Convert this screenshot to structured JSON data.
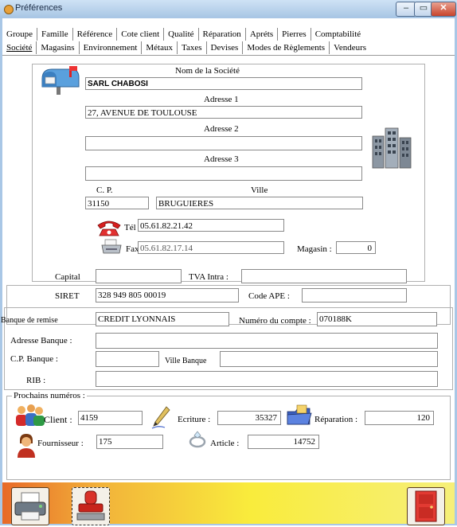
{
  "window": {
    "title": "Préférences",
    "controls": {
      "minimize": "–",
      "maximize": "▭",
      "close": "✕"
    }
  },
  "tabs_row1": [
    "Groupe",
    "Famille",
    "Référence",
    "Cote client",
    "Qualité",
    "Réparation",
    "Apréts",
    "Pierres",
    "Comptabilité"
  ],
  "tabs_row2": [
    "Société",
    "Magasins",
    "Environnement",
    "Métaux",
    "Taxes",
    "Devises",
    "Modes de Règlements",
    "Vendeurs"
  ],
  "company": {
    "name_label": "Nom de la Société",
    "name_value": "SARL CHABOSI",
    "address1_label": "Adresse 1",
    "address1_value": "27, AVENUE DE TOULOUSE",
    "address2_label": "Adresse 2",
    "address2_value": "",
    "address3_label": "Adresse 3",
    "address3_value": "",
    "cp_label": "C. P.",
    "cp_value": "31150",
    "ville_label": "Ville",
    "ville_value": "BRUGUIERES",
    "tel_label": "Tél :",
    "tel_value": "05.61.82.21.42",
    "fax_label": "Fax",
    "fax_value": "05.61.82.17.14",
    "magasin_label": "Magasin :",
    "magasin_value": "0"
  },
  "legal": {
    "capital_label": "Capital",
    "capital_value": "",
    "tva_label": "TVA Intra :",
    "tva_value": "",
    "siret_label": "SIRET",
    "siret_value": "328 949 805 00019",
    "ape_label": "Code APE :",
    "ape_value": ""
  },
  "bank": {
    "banque_label": "Banque de remise",
    "banque_value": "CREDIT LYONNAIS",
    "compte_label": "Numéro du compte :",
    "compte_value": "070188K",
    "adresse_label": "Adresse Banque :",
    "adresse_value": "",
    "cp_label": "C.P. Banque :",
    "cp_value": "",
    "ville_label": "Ville Banque",
    "ville_value": "",
    "rib_label": "RIB :",
    "rib_value": ""
  },
  "numbers": {
    "section_label": "Prochains numéros :",
    "client_label": "Client :",
    "client_value": "4159",
    "ecriture_label": "Ecriture :",
    "ecriture_value": "35327",
    "reparation_label": "Réparation :",
    "reparation_value": "120",
    "fournisseur_label": "Fournisseur :",
    "fournisseur_value": "175",
    "article_label": "Article :",
    "article_value": "14752"
  },
  "icons": {
    "mailbox": "mailbox-icon",
    "buildings": "buildings-icon",
    "phone": "phone-icon",
    "fax": "fax-icon",
    "clients": "clients-icon",
    "pen": "pen-icon",
    "folder": "folder-icon",
    "supplier": "supplier-icon",
    "ring": "ring-icon",
    "printer": "printer-icon",
    "stamp": "stamp-icon",
    "exit": "exit-door-icon"
  },
  "colors": {
    "title_bar": "#a8c6e4",
    "footer_start": "#e86a28",
    "footer_end": "#f6ef7a",
    "close_button": "#c8442c"
  }
}
